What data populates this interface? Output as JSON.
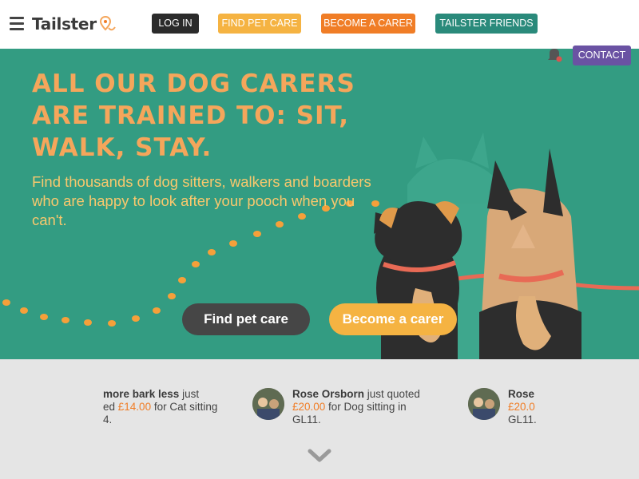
{
  "brand": {
    "name": "Tailster",
    "accent": "#f07d26"
  },
  "nav": {
    "menu_icon": "hamburger-icon",
    "login": "LOG IN",
    "find_pet_care": "FIND PET CARE",
    "become_carer": "BECOME A CARER",
    "friends": "TAILSTER FRIENDS"
  },
  "hero": {
    "title": "ALL OUR DOG CARERS ARE TRAINED TO: SIT, WALK, STAY.",
    "subtitle": "Find thousands of dog sitters, walkers and boarders who are happy to look after your pooch when you can't.",
    "cta_find": "Find pet care",
    "cta_carer": "Become a carer",
    "background_color": "#339c82"
  },
  "contact": {
    "label": "CONTACT",
    "bell_icon": "bell-icon"
  },
  "feed": [
    {
      "name": "more bark less",
      "action": " just",
      "line2_prefix": "ed ",
      "price": "£14.00",
      "line2_suffix": " for Cat sitting",
      "line3": "4."
    },
    {
      "name": "Rose Orsborn",
      "action": " just quoted",
      "line2_prefix": "",
      "price": "£20.00",
      "line2_suffix": " for Dog sitting in",
      "line3": "GL11."
    },
    {
      "name": "Rose O",
      "action": "",
      "line2_prefix": "",
      "price": "£20.0",
      "line2_suffix": "",
      "line3": "GL11."
    }
  ],
  "scroll_icon": "chevron-down-icon"
}
